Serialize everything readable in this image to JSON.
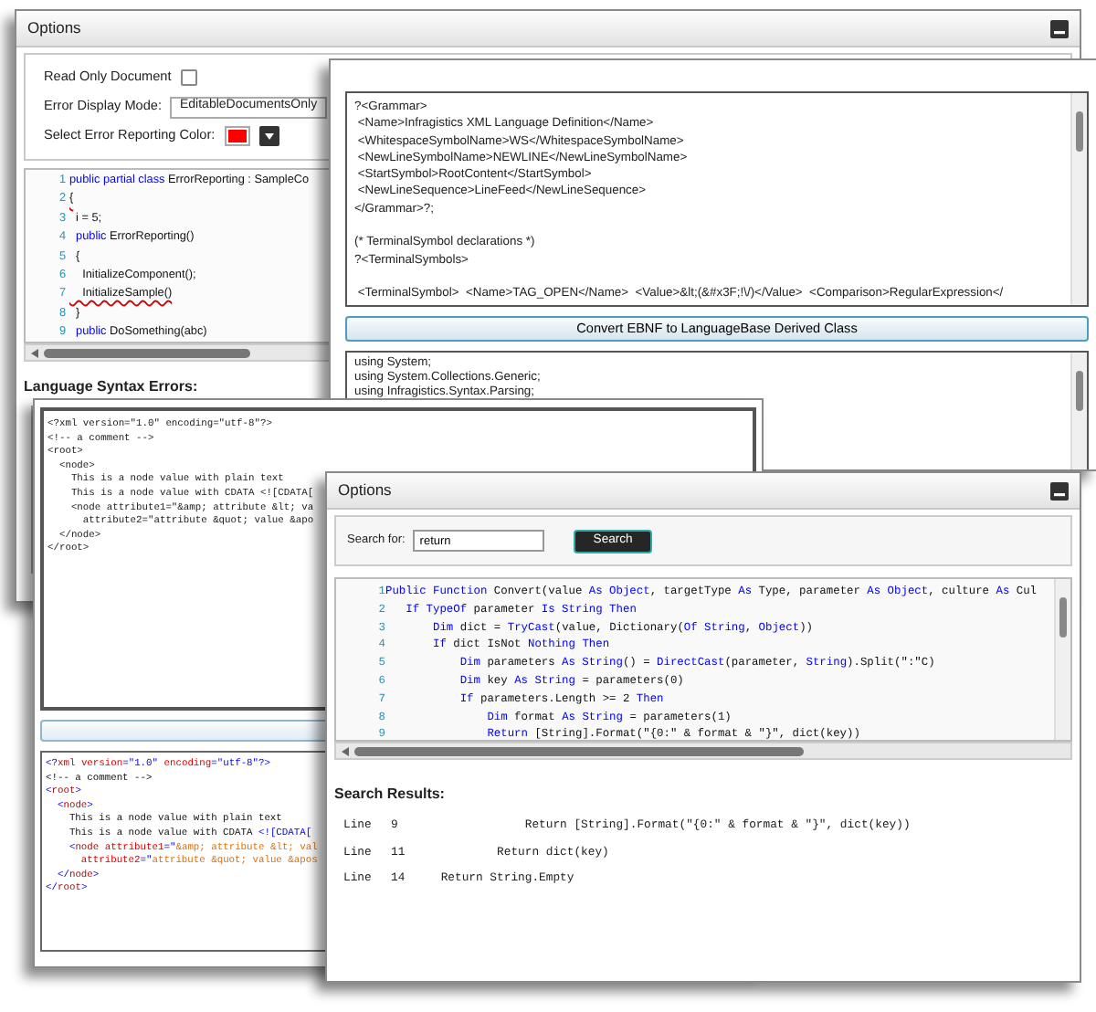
{
  "options_window": {
    "title": "Options",
    "read_only": {
      "label": "Read Only Document",
      "checked": false
    },
    "error_display_mode": {
      "label": "Error Display Mode:",
      "value": "EditableDocumentsOnly"
    },
    "error_color": {
      "label": "Select Error Reporting Color:",
      "color": "#ff0000"
    },
    "code_lines": [
      {
        "number": "1",
        "error": false,
        "segments": [
          {
            "text": "public partial class",
            "kind": "kw"
          },
          {
            "text": " ErrorReporting : SampleCo",
            "kind": "plain"
          }
        ]
      },
      {
        "number": "2",
        "error": true,
        "segments": [
          {
            "text": "{",
            "kind": "plain"
          }
        ]
      },
      {
        "number": "3",
        "error": false,
        "segments": [
          {
            "text": "  i = 5;",
            "kind": "plain"
          }
        ]
      },
      {
        "number": "4",
        "error": false,
        "segments": [
          {
            "text": "  public",
            "kind": "kw"
          },
          {
            "text": " ErrorReporting()",
            "kind": "plain"
          }
        ]
      },
      {
        "number": "5",
        "error": false,
        "segments": [
          {
            "text": "  {",
            "kind": "plain"
          }
        ]
      },
      {
        "number": "6",
        "error": false,
        "segments": [
          {
            "text": "    InitializeComponent();",
            "kind": "plain"
          }
        ]
      },
      {
        "number": "7",
        "error": true,
        "segments": [
          {
            "text": "    InitializeSample()",
            "kind": "plain"
          }
        ]
      },
      {
        "number": "8",
        "error": false,
        "segments": [
          {
            "text": "  }",
            "kind": "plain"
          }
        ]
      },
      {
        "number": "9",
        "error": false,
        "segments": [
          {
            "text": "  public",
            "kind": "kw"
          },
          {
            "text": " DoSomething(abc)",
            "kind": "plain"
          }
        ]
      }
    ],
    "syntax_errors_label": "Language Syntax Errors:"
  },
  "grammar_window": {
    "grammar_blocks": [
      [
        "?<Grammar>",
        " <Name>Infragistics XML Language Definition</Name>",
        " <WhitespaceSymbolName>WS</WhitespaceSymbolName>",
        " <NewLineSymbolName>NEWLINE</NewLineSymbolName>",
        " <StartSymbol>RootContent</StartSymbol>",
        " <NewLineSequence>LineFeed</NewLineSequence>",
        "</Grammar>?;"
      ],
      [
        "(* TerminalSymbol declarations *)",
        "?<TerminalSymbols>"
      ],
      [
        " <TerminalSymbol>  <Name>TAG_OPEN</Name>  <Value>&lt;(&#x3F;!\\/)</Value>  <Comparison>RegularExpression</"
      ]
    ],
    "convert_button": "Convert EBNF to LanguageBase Derived Class",
    "output_lines": [
      "using System;",
      "using System.Collections.Generic;",
      "using Infragistics.Syntax.Parsing;"
    ]
  },
  "xml_window": {
    "plain_lines": [
      "<?xml version=\"1.0\" encoding=\"utf-8\"?>",
      "<!-- a comment -->",
      "<root>",
      "  <node>",
      "    This is a node value with plain text",
      "    This is a node value with CDATA <![CDATA[",
      "    <node attribute1=\"&amp; attribute &lt; va",
      "      attribute2=\"attribute &quot; value &apo",
      "  </node>",
      "</root>"
    ],
    "colored_lines": [
      [
        {
          "text": "<?",
          "kind": "punct"
        },
        {
          "text": "xml",
          "kind": "element"
        },
        {
          "text": " version",
          "kind": "attribute"
        },
        {
          "text": "=\"1.0\"",
          "kind": "punct"
        },
        {
          "text": " encoding",
          "kind": "attribute"
        },
        {
          "text": "=\"utf-8\"?>",
          "kind": "punct"
        }
      ],
      [
        {
          "text": "<!-- a comment -->",
          "kind": "text"
        }
      ],
      [
        {
          "text": "<",
          "kind": "punct"
        },
        {
          "text": "root",
          "kind": "element"
        },
        {
          "text": ">",
          "kind": "punct"
        }
      ],
      [
        {
          "text": "  <",
          "kind": "punct"
        },
        {
          "text": "node",
          "kind": "element"
        },
        {
          "text": ">",
          "kind": "punct"
        }
      ],
      [
        {
          "text": "    This is a node value with plain text",
          "kind": "text"
        }
      ],
      [
        {
          "text": "    This is a node value with CDATA ",
          "kind": "text"
        },
        {
          "text": "<![CDATA[",
          "kind": "punct"
        }
      ],
      [
        {
          "text": "    <",
          "kind": "punct"
        },
        {
          "text": "node",
          "kind": "element"
        },
        {
          "text": " attribute1",
          "kind": "attribute"
        },
        {
          "text": "=\"",
          "kind": "punct"
        },
        {
          "text": "&amp; attribute &lt; val",
          "kind": "value"
        }
      ],
      [
        {
          "text": "      attribute2",
          "kind": "attribute"
        },
        {
          "text": "=\"",
          "kind": "punct"
        },
        {
          "text": "attribute &quot; value &apos",
          "kind": "value"
        }
      ],
      [
        {
          "text": "  </",
          "kind": "punct"
        },
        {
          "text": "node",
          "kind": "element"
        },
        {
          "text": ">",
          "kind": "punct"
        }
      ],
      [
        {
          "text": "</",
          "kind": "punct"
        },
        {
          "text": "root",
          "kind": "element"
        },
        {
          "text": ">",
          "kind": "punct"
        }
      ]
    ]
  },
  "search_window": {
    "title": "Options",
    "search_label": "Search for:",
    "search_value": "return",
    "search_button": "Search",
    "code_lines": [
      {
        "number": "1",
        "segments": [
          {
            "text": "Public Function",
            "kind": "kw"
          },
          {
            "text": " Convert(value ",
            "kind": "plain"
          },
          {
            "text": "As Object",
            "kind": "kw"
          },
          {
            "text": ", targetType ",
            "kind": "plain"
          },
          {
            "text": "As",
            "kind": "kw"
          },
          {
            "text": " Type, parameter ",
            "kind": "plain"
          },
          {
            "text": "As Object",
            "kind": "kw"
          },
          {
            "text": ", culture ",
            "kind": "plain"
          },
          {
            "text": "As",
            "kind": "kw"
          },
          {
            "text": " Cul",
            "kind": "plain"
          }
        ]
      },
      {
        "number": "2",
        "segments": [
          {
            "text": "   If TypeOf",
            "kind": "kw"
          },
          {
            "text": " parameter ",
            "kind": "plain"
          },
          {
            "text": "Is String Then",
            "kind": "kw"
          }
        ]
      },
      {
        "number": "3",
        "segments": [
          {
            "text": "       Dim",
            "kind": "kw"
          },
          {
            "text": " dict = ",
            "kind": "plain"
          },
          {
            "text": "TryCast",
            "kind": "kw"
          },
          {
            "text": "(value, Dictionary(",
            "kind": "plain"
          },
          {
            "text": "Of String",
            "kind": "kw"
          },
          {
            "text": ", ",
            "kind": "plain"
          },
          {
            "text": "Object",
            "kind": "kw"
          },
          {
            "text": "))",
            "kind": "plain"
          }
        ]
      },
      {
        "number": "4",
        "segments": [
          {
            "text": "       If",
            "kind": "kw"
          },
          {
            "text": " dict IsNot ",
            "kind": "plain"
          },
          {
            "text": "Nothing Then",
            "kind": "kw"
          }
        ]
      },
      {
        "number": "5",
        "segments": [
          {
            "text": "           Dim",
            "kind": "kw"
          },
          {
            "text": " parameters ",
            "kind": "plain"
          },
          {
            "text": "As String",
            "kind": "kw"
          },
          {
            "text": "() = ",
            "kind": "plain"
          },
          {
            "text": "DirectCast",
            "kind": "kw"
          },
          {
            "text": "(parameter, ",
            "kind": "plain"
          },
          {
            "text": "String",
            "kind": "kw"
          },
          {
            "text": ").Split(\":\"C)",
            "kind": "plain"
          }
        ]
      },
      {
        "number": "6",
        "segments": [
          {
            "text": "           Dim",
            "kind": "kw"
          },
          {
            "text": " key ",
            "kind": "plain"
          },
          {
            "text": "As String",
            "kind": "kw"
          },
          {
            "text": " = parameters(0)",
            "kind": "plain"
          }
        ]
      },
      {
        "number": "7",
        "segments": [
          {
            "text": "           If",
            "kind": "kw"
          },
          {
            "text": " parameters.Length >= 2 ",
            "kind": "plain"
          },
          {
            "text": "Then",
            "kind": "kw"
          }
        ]
      },
      {
        "number": "8",
        "segments": [
          {
            "text": "               Dim",
            "kind": "kw"
          },
          {
            "text": " format ",
            "kind": "plain"
          },
          {
            "text": "As String",
            "kind": "kw"
          },
          {
            "text": " = parameters(1)",
            "kind": "plain"
          }
        ]
      },
      {
        "number": "9",
        "segments": [
          {
            "text": "               Return",
            "kind": "kw"
          },
          {
            "text": " [String].Format(\"{0:\" & format & \"}\", dict(key))",
            "kind": "plain"
          }
        ]
      }
    ],
    "results_label": "Search Results:",
    "results": [
      {
        "label": "Line",
        "line": "9",
        "text": "                Return [String].Format(\"{0:\" & format & \"}\", dict(key))"
      },
      {
        "label": "Line",
        "line": "11",
        "text": "            Return dict(key)"
      },
      {
        "label": "Line",
        "line": "14",
        "text": "    Return String.Empty"
      }
    ]
  }
}
